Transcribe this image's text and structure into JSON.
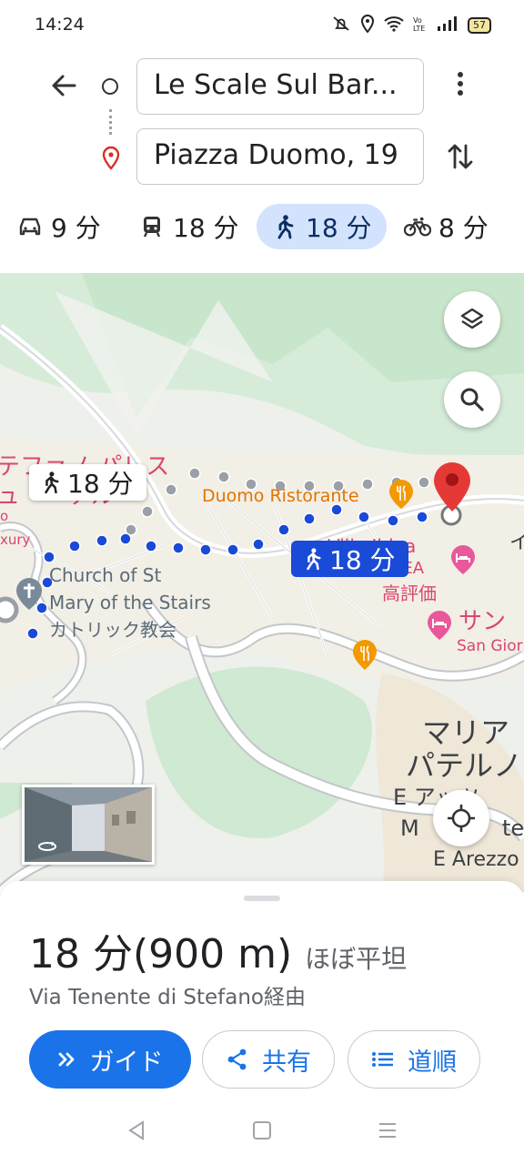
{
  "status": {
    "time": "14:24",
    "battery": "57",
    "icons": [
      "mute-icon",
      "location-icon",
      "wifi-icon",
      "volte-icon",
      "signal-icon",
      "battery-icon"
    ]
  },
  "search": {
    "origin": "Le Scale Sul Bar...",
    "destination": "Piazza Duomo, 19"
  },
  "modes": [
    {
      "icon": "car-icon",
      "label": "9 分"
    },
    {
      "icon": "train-icon",
      "label": "18 分"
    },
    {
      "icon": "walk-icon",
      "label": "18 分",
      "active": true
    },
    {
      "icon": "bike-icon",
      "label": "8 分"
    }
  ],
  "map": {
    "labels": {
      "palace_jp_1": "テファノ パレス",
      "palace_jp_2": "ュ　　テル",
      "duomo": "Duomo Ristorante",
      "luxury": "xury",
      "church_1": "Church of St",
      "church_2": "Mary of the Stairs",
      "church_3": "カトリック教会",
      "villa_1": "Villa Iblea",
      "villa_2": "BLEA",
      "villa_3": "高評価",
      "san_jp": "サン",
      "san_giorgio": "San Gior",
      "maria_1": "マリア",
      "maria_2": "パテルノ",
      "maria_3": "E アッツ",
      "maria_4": "M",
      "maria_5": "te",
      "maria_6": "E Arezzo",
      "ia_jp": "イ",
      "o_fragment": "o"
    },
    "route_gray_label": "18 分",
    "route_blue_label": "18 分"
  },
  "sheet": {
    "duration": "18 分",
    "distance": "(900 m)",
    "terrain": "ほぼ平坦",
    "via": "Via Tenente di Stefano経由",
    "guide_label": "ガイド",
    "share_label": "共有",
    "steps_label": "道順"
  },
  "colors": {
    "accent": "#1a73e8",
    "route_blue": "#1a4ad8",
    "pin_red": "#e53935",
    "poi_orange": "#f29900",
    "poi_pink": "#e8589a"
  }
}
